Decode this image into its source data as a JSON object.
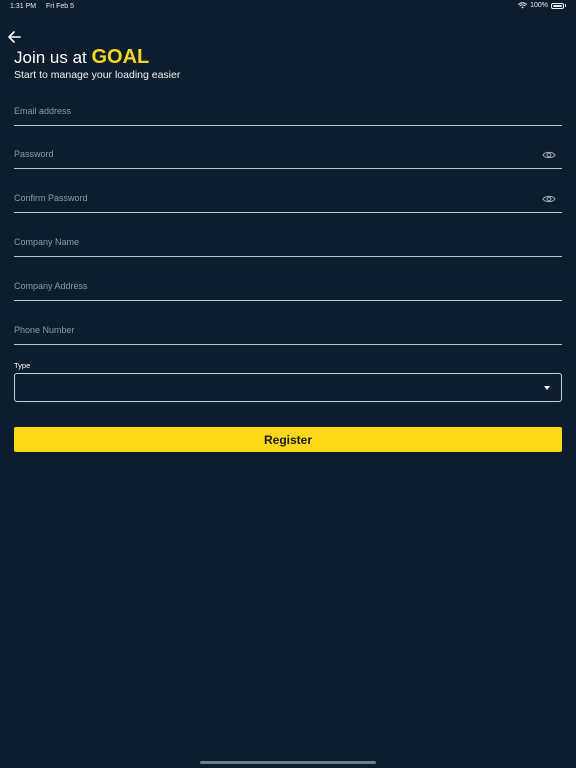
{
  "status_bar": {
    "time": "1:31 PM",
    "date": "Fri Feb 5",
    "battery": "100%"
  },
  "header": {
    "back_icon": "arrow-left-icon",
    "title_prefix": "Join us at ",
    "title_brand": "GOAL",
    "subtitle": "Start to manage your loading easier"
  },
  "form": {
    "email": {
      "placeholder": "Email address",
      "value": ""
    },
    "password": {
      "placeholder": "Password",
      "value": "",
      "icon": "eye-icon"
    },
    "confirm_password": {
      "placeholder": "Confirm Password",
      "value": "",
      "icon": "eye-icon"
    },
    "company_name": {
      "placeholder": "Company Name",
      "value": ""
    },
    "company_address": {
      "placeholder": "Company Address",
      "value": ""
    },
    "phone_number": {
      "placeholder": "Phone Number",
      "value": ""
    },
    "type": {
      "label": "Type",
      "selected": ""
    },
    "register_label": "Register"
  },
  "colors": {
    "background": "#0c1e2e",
    "accent": "#fcd716",
    "brand_text": "#f6d623",
    "field_line": "#b9c3cc",
    "placeholder": "#8d9ba8"
  }
}
